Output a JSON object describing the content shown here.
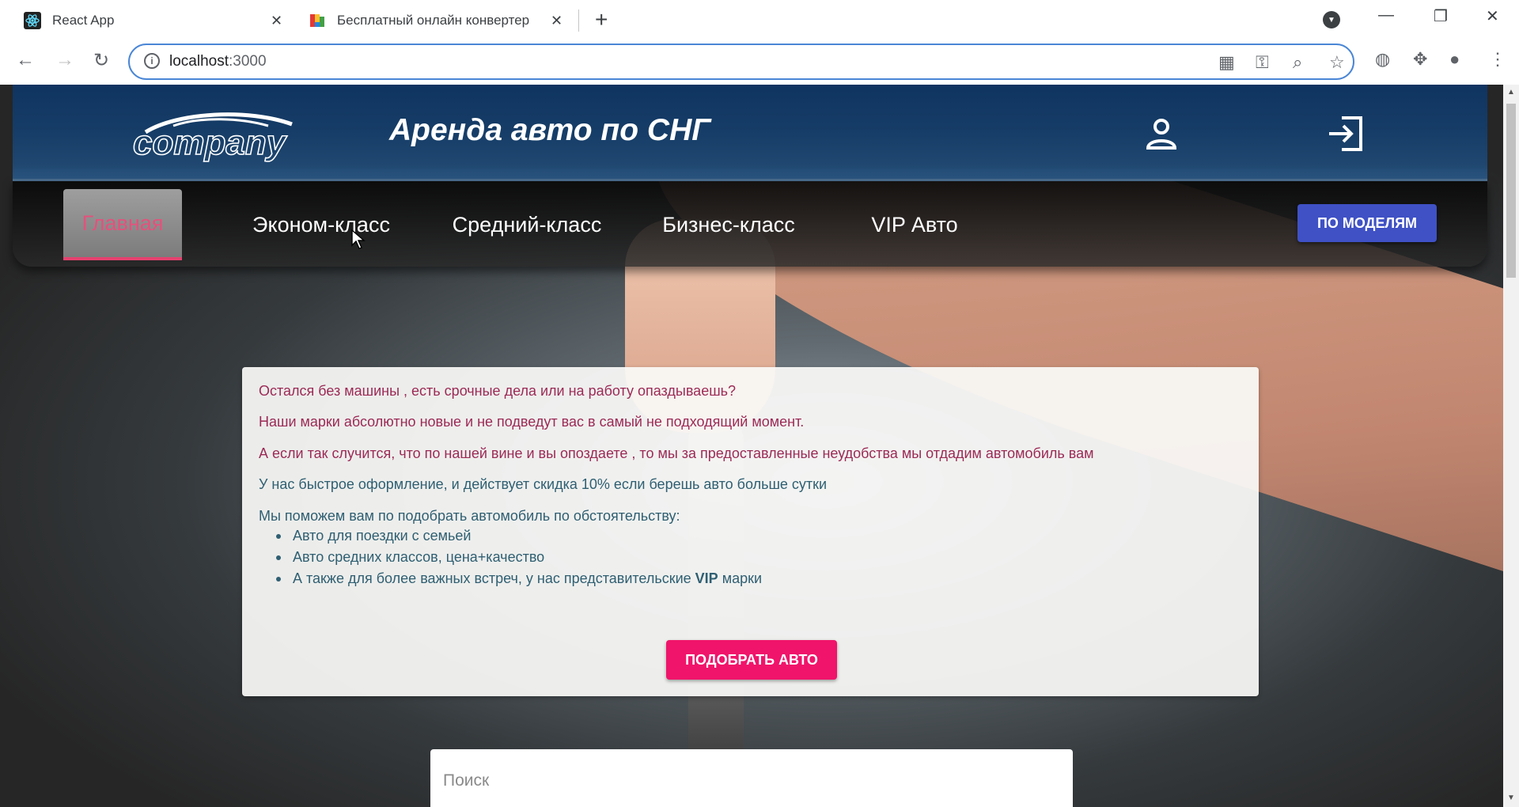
{
  "browser": {
    "tabs": [
      {
        "title": "React App"
      },
      {
        "title": "Бесплатный онлайн конвертер"
      }
    ],
    "url_host": "localhost",
    "url_port": ":3000"
  },
  "header": {
    "title": "Аренда авто по СНГ",
    "logo_text": "company"
  },
  "nav": {
    "items": [
      {
        "label": "Главная",
        "active": true
      },
      {
        "label": "Эконом-класс"
      },
      {
        "label": "Средний-класс"
      },
      {
        "label": "Бизнес-класс"
      },
      {
        "label": "VIP Авто"
      }
    ],
    "models_button": "ПО МОДЕЛЯМ"
  },
  "card": {
    "p1": "Остался без машины , есть срочные дела или на работу опаздываешь?",
    "p2": "Наши марки абсолютно новые и не подведут вас в самый не подходящий момент.",
    "p3": "А если так случится, что по нашей вине и вы опоздаете , то мы за предоставленные неудобства мы отдадим автомобиль вам",
    "p4": "У нас быстрое оформление, и действует скидка 10% если берешь авто больше сутки",
    "p5": "Мы поможем вам по подобрать автомобиль по обстоятельству:",
    "list": [
      "Авто для поездки с семьей",
      "Авто средних классов, цена+качество"
    ],
    "list_last_pre": "А также для более важных встреч, у нас представительские",
    "list_last_bold": "VIP",
    "list_last_post": "марки",
    "button": "ПОДОБРАТЬ АВТО"
  },
  "search": {
    "placeholder": "Поиск"
  },
  "colors": {
    "header_bg": "#0f3460",
    "accent_pink": "#f0146a",
    "models_button": "#3f51c5",
    "active_nav_text": "#e5517c"
  }
}
